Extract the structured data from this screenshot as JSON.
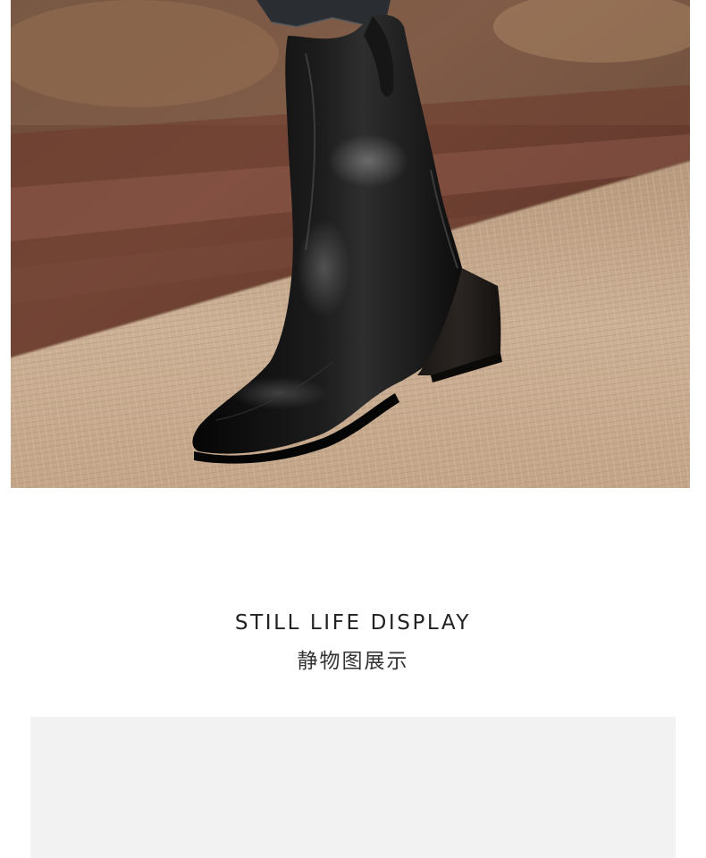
{
  "hero_image": {
    "subject": "black-leather-square-toe-block-heel-ankle-boot",
    "colors": {
      "boot": "#0d0d0d",
      "rug": "#c9ac90",
      "background": "#5b3a2c",
      "denim": "#2a2d31"
    }
  },
  "section_title": {
    "en": "STILL LIFE DISPLAY",
    "zh": "静物图展示"
  },
  "next_panel": {
    "color": "#f2f2f2"
  }
}
